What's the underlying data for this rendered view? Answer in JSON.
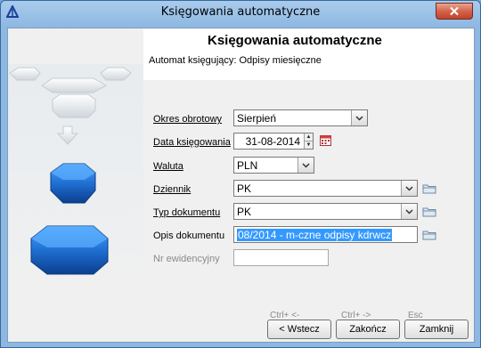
{
  "window": {
    "title": "Księgowania automatyczne"
  },
  "header": {
    "title": "Księgowania automatyczne",
    "subtitle": "Automat księgujący: Odpisy miesięczne"
  },
  "form": {
    "okres": {
      "label": "Okres obrotowy",
      "value": "Sierpień"
    },
    "data": {
      "label": "Data księgowania",
      "value": "31-08-2014"
    },
    "waluta": {
      "label": "Waluta",
      "value": "PLN"
    },
    "dziennik": {
      "label": "Dziennik",
      "value": "PK"
    },
    "typ": {
      "label": "Typ dokumentu",
      "value": "PK"
    },
    "opis": {
      "label": "Opis dokumentu",
      "value": "08/2014 - m-czne odpisy kdrwcz"
    },
    "nr": {
      "label": "Nr ewidencyjny",
      "value": ""
    }
  },
  "footer": {
    "shortcuts": {
      "back": "Ctrl+ <-",
      "finish": "Ctrl+ ->",
      "close": "Esc"
    },
    "buttons": {
      "back": "< Wstecz",
      "finish": "Zakończ",
      "close": "Zamknij"
    }
  },
  "colors": {
    "selection": "#3399ff",
    "accent_blue": "#1f6fd1",
    "close_red": "#c0432a"
  }
}
